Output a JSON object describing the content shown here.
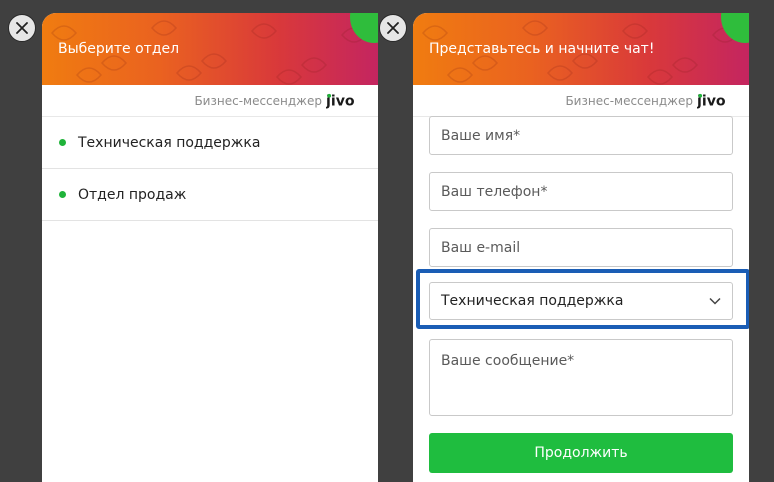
{
  "left_panel": {
    "header_title": "Выберите отдел",
    "brand_text": "Бизнес-мессенджер",
    "brand_logo": "jivo",
    "departments": [
      {
        "label": "Техническая поддержка"
      },
      {
        "label": "Отдел продаж"
      }
    ]
  },
  "right_panel": {
    "header_title": "Представьтесь и начните чат!",
    "brand_text": "Бизнес-мессенджер",
    "brand_logo": "jivo",
    "form": {
      "name_placeholder": "Ваше имя*",
      "phone_placeholder": "Ваш телефон*",
      "email_placeholder": "Ваш e-mail",
      "department_selected": "Техническая поддержка",
      "message_placeholder": "Ваше сообщение*",
      "submit_label": "Продолжить"
    }
  },
  "colors": {
    "accent_green": "#1fbd3f",
    "highlight_blue": "#1a5db5",
    "header_gradient_start": "#f07c10",
    "header_gradient_end": "#c42560"
  },
  "icons": {
    "close": "close-icon",
    "chevron": "chevron-down-icon",
    "status_dot": "online-dot-icon"
  }
}
